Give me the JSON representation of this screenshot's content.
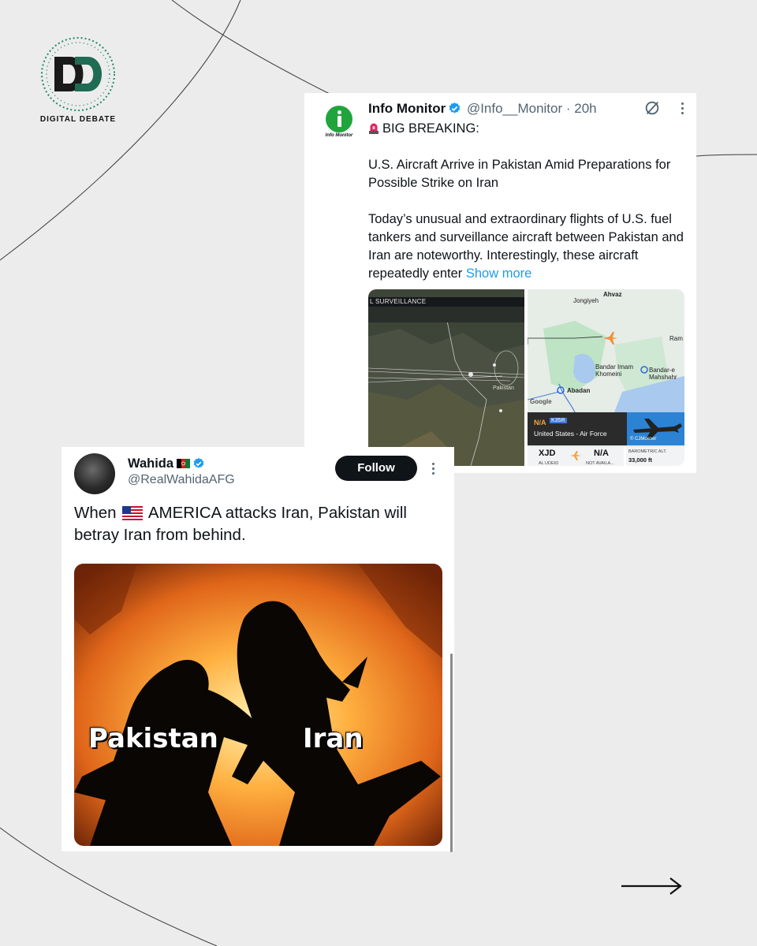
{
  "brand": {
    "name": "DIGITAL DEBATE",
    "logo_icon": "dd-logo-icon"
  },
  "tweet1": {
    "account_name": "Info Monitor",
    "handle": "@Info__Monitor",
    "time": "· 20h",
    "avatar_caption": "Info Monitor",
    "headline": "BIG BREAKING:",
    "paragraph1": "U.S. Aircraft Arrive in Pakistan Amid Preparations for Possible Strike on Iran",
    "paragraph2": "Today’s unusual and extraordinary flights of U.S. fuel tankers and surveillance aircraft between Pakistan and Iran are noteworthy. Interestingly, these aircraft repeatedly enter",
    "show_more": "Show more",
    "media": {
      "left_header": "L SURVEILLANCE",
      "left_map_label": "Pakistan",
      "map_places": [
        "Ahvaz",
        "Jongiyeh",
        "Ram",
        "Bandar Imam Khomeini",
        "Bandar-e Mahshahr",
        "Abadan",
        "Google"
      ],
      "flight_status": "N/A",
      "aircraft_type": "K35R",
      "operator": "United States - Air Force",
      "photo_credit": "© CJMoeser",
      "origin_code": "XJD",
      "origin_name": "AL UDEID",
      "destination_code": "N/A",
      "destination_name": "NOT AVAILA...",
      "alt_label": "BAROMETRIC ALT.",
      "alt_value": "33,000 ft"
    }
  },
  "tweet2": {
    "account_name": "Wahida",
    "handle": "@RealWahidaAFG",
    "follow_label": "Follow",
    "text_before_flag": "When",
    "text_after_flag": "AMERICA attacks Iran, Pakistan will betray Iran from behind.",
    "meme_left_label": "Pakistan",
    "meme_right_label": "Iran"
  },
  "colors": {
    "background": "#ececec",
    "accent_blue": "#1d9bf0",
    "follow_button": "#0f1419",
    "brand_green": "#1f8a6b"
  }
}
